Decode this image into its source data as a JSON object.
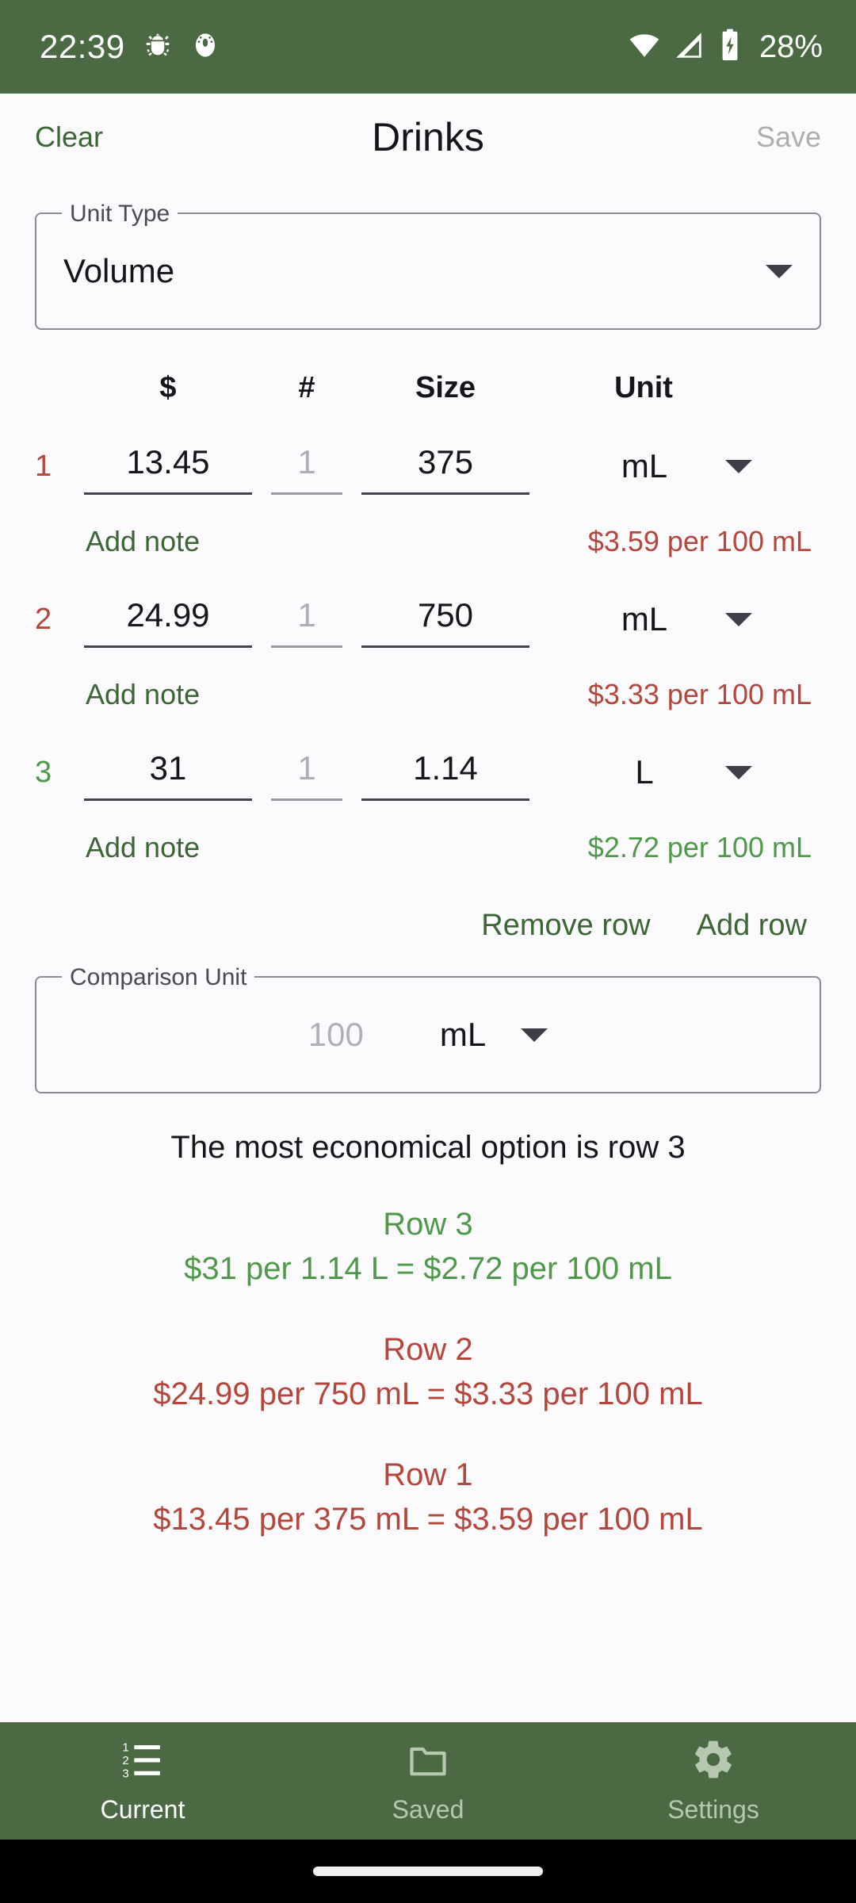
{
  "status_bar": {
    "time": "22:39",
    "icons": [
      "android-debug-icon",
      "bug-report-icon",
      "wifi-icon",
      "cellular-signal-icon",
      "battery-charging-icon"
    ],
    "battery_percent": "28%"
  },
  "app_bar": {
    "clear_label": "Clear",
    "title": "Drinks",
    "save_label": "Save"
  },
  "unit_type": {
    "legend": "Unit Type",
    "value": "Volume"
  },
  "table": {
    "headers": {
      "index": "",
      "price": "$",
      "quantity": "#",
      "size": "Size",
      "unit": "Unit"
    },
    "rows": [
      {
        "index": "1",
        "price": "13.45",
        "quantity_placeholder": "1",
        "size": "375",
        "unit": "mL",
        "note_label": "Add note",
        "unit_price": "$3.59 per 100 mL",
        "status": "bad"
      },
      {
        "index": "2",
        "price": "24.99",
        "quantity_placeholder": "1",
        "size": "750",
        "unit": "mL",
        "note_label": "Add note",
        "unit_price": "$3.33 per 100 mL",
        "status": "bad"
      },
      {
        "index": "3",
        "price": "31",
        "quantity_placeholder": "1",
        "size": "1.14",
        "unit": "L",
        "note_label": "Add note",
        "unit_price": "$2.72 per 100 mL",
        "status": "good"
      }
    ],
    "remove_row_label": "Remove row",
    "add_row_label": "Add row"
  },
  "comparison_unit": {
    "legend": "Comparison Unit",
    "quantity_placeholder": "100",
    "unit": "mL"
  },
  "results": {
    "headline": "The most economical option is row 3",
    "items": [
      {
        "title": "Row 3",
        "detail": "$31 per 1.14 L = $2.72 per 100 mL",
        "status": "good"
      },
      {
        "title": "Row 2",
        "detail": "$24.99 per 750 mL = $3.33 per 100 mL",
        "status": "bad"
      },
      {
        "title": "Row 1",
        "detail": "$13.45 per 375 mL = $3.59 per 100 mL",
        "status": "bad"
      }
    ]
  },
  "bottom_nav": {
    "items": [
      {
        "label": "Current",
        "icon": "numbered-list-icon",
        "active": true
      },
      {
        "label": "Saved",
        "icon": "folder-icon",
        "active": false
      },
      {
        "label": "Settings",
        "icon": "gear-icon",
        "active": false
      }
    ]
  },
  "colors": {
    "brand_green": "#4b6a43",
    "accent_green": "#3d6636",
    "good_green": "#4f9a4a",
    "bad_red": "#b5463c",
    "background": "#fbfafc",
    "disabled_gray": "#aeaeae"
  }
}
